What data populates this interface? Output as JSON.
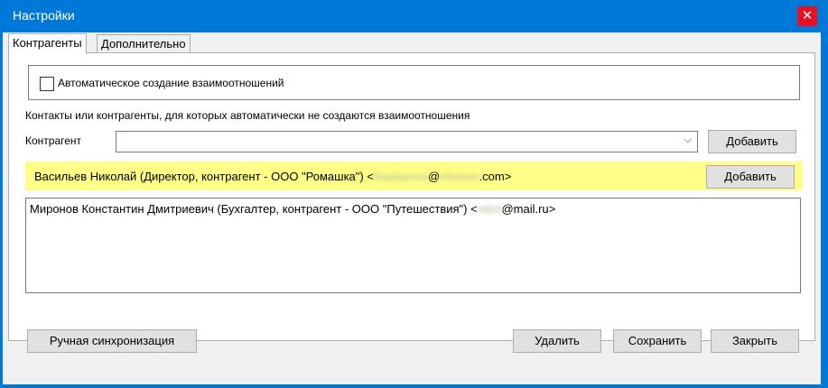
{
  "window": {
    "title": "Настройки",
    "close_glyph": "✕"
  },
  "tabs": [
    {
      "label": "Контрагенты",
      "active": true
    },
    {
      "label": "Дополнительно",
      "active": false
    }
  ],
  "auto_relations": {
    "checkbox_label": "Автоматическое создание взаимоотношений",
    "checked": false
  },
  "exclusions": {
    "info_text": "Контакты или контрагенты, для которых автоматически не создаются взаимоотношения",
    "field_label": "Контрагент",
    "combo_value": "",
    "combo_arrow": "⌵",
    "add_button_label": "Добавить"
  },
  "suggestion": {
    "text_prefix": "Васильев Николай (Директор, контрагент - ООО \"Ромашка\") <",
    "email_user_blurred": "lhaidarova",
    "email_at": "@",
    "email_domain_blurred": "elewise",
    "email_tld": ".com>",
    "add_button_label": "Добавить"
  },
  "list_items": [
    {
      "prefix": "Миронов Константин Дмитриевич (Бухгалтер, контрагент - ООО \"Путешествия\") <",
      "user_blurred": "nikol",
      "suffix": "@mail.ru>"
    }
  ],
  "footer": {
    "manual_sync_label": "Ручная синхронизация",
    "delete_label": "Удалить",
    "save_label": "Сохранить",
    "close_label": "Закрыть"
  }
}
